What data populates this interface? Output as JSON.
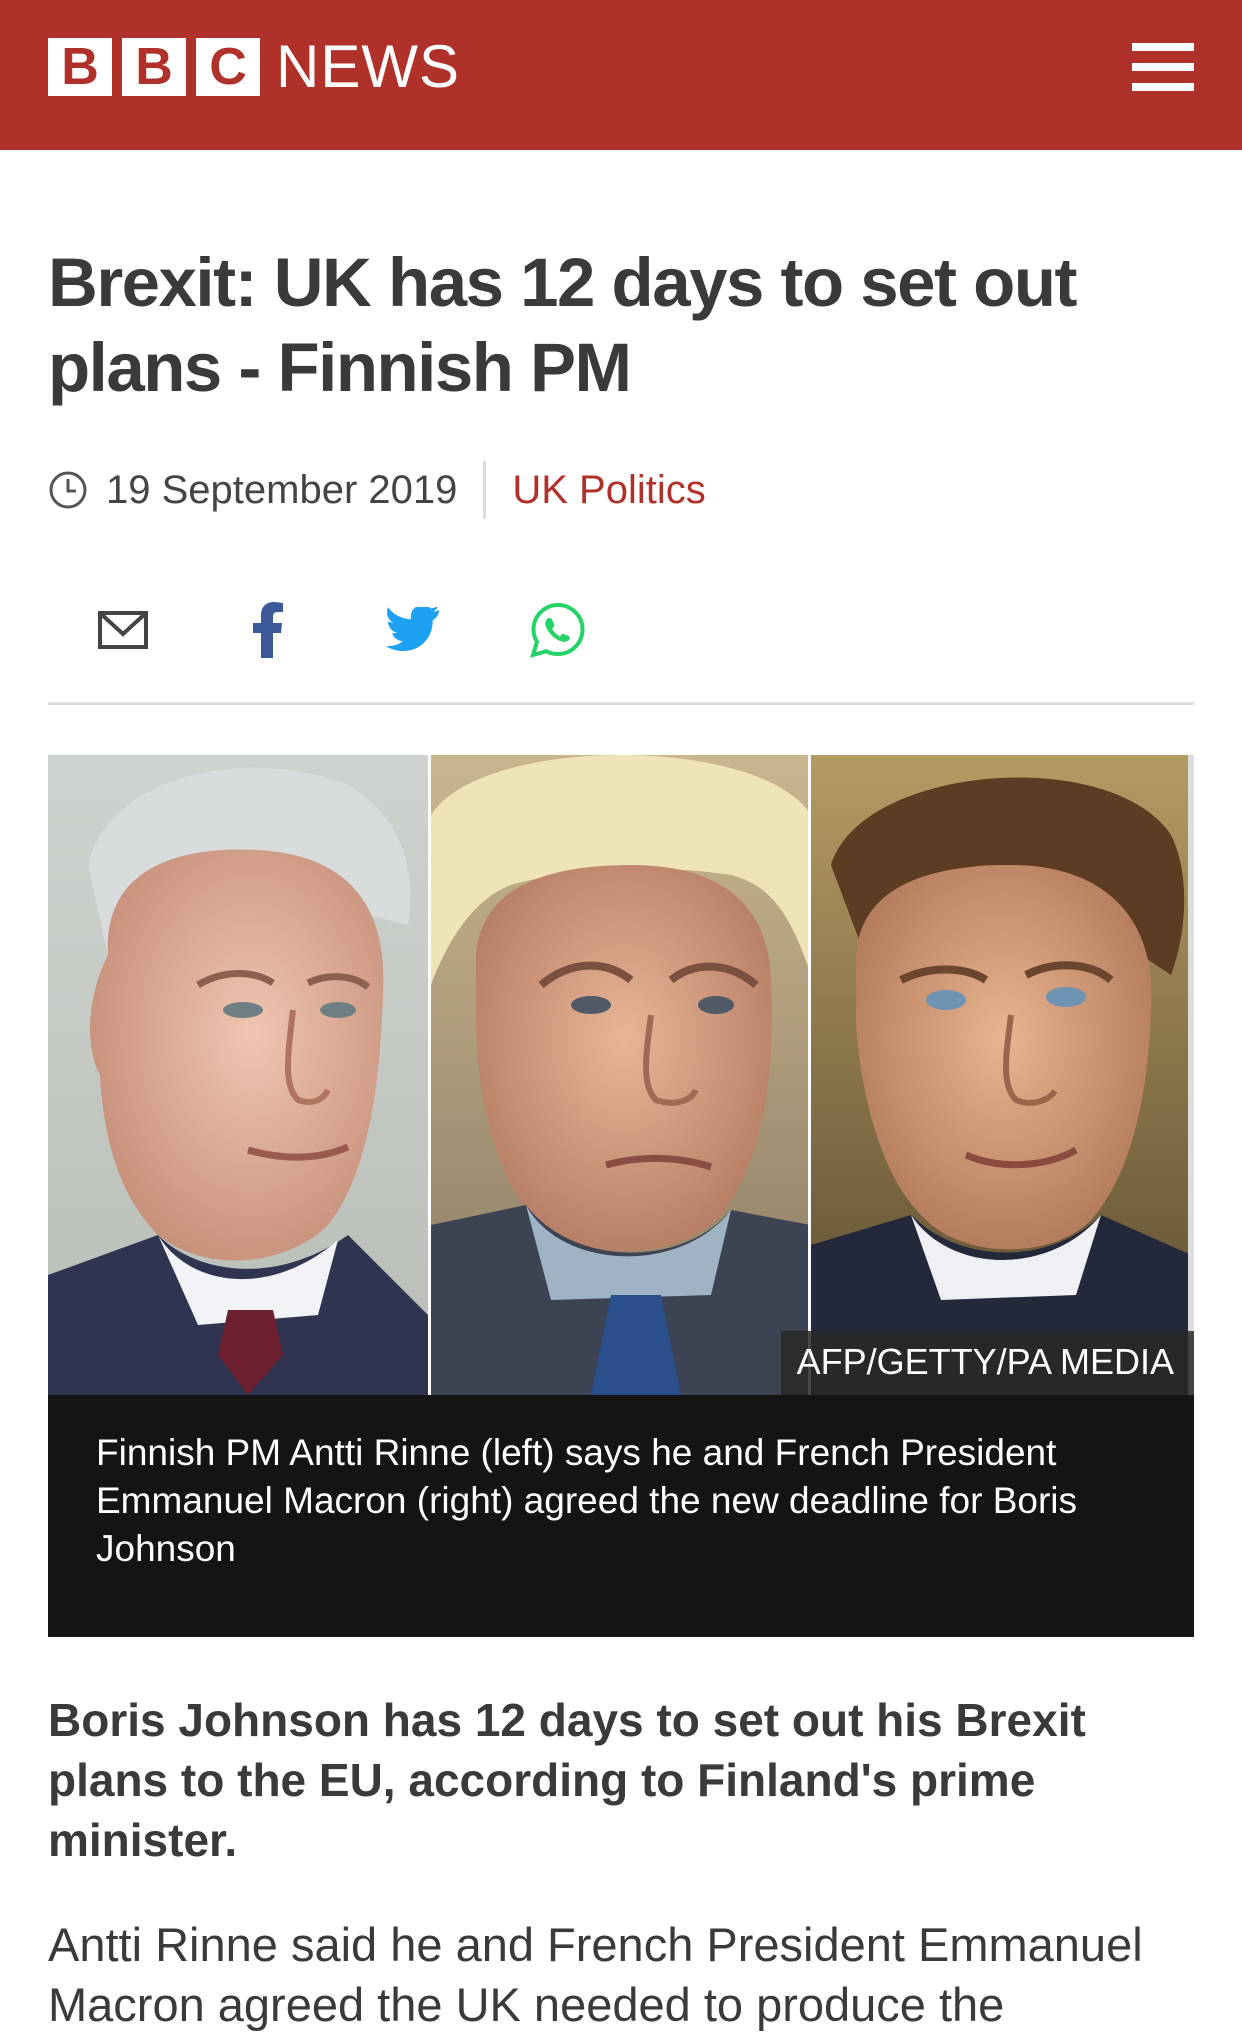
{
  "header": {
    "logo_letters": [
      "B",
      "B",
      "C"
    ],
    "logo_news": "NEWS",
    "brand_color": "#b0302a",
    "menu_icon": "hamburger-menu-icon"
  },
  "article": {
    "headline": "Brexit: UK has 12 days to set out plans - Finnish PM",
    "date": "19 September 2019",
    "category": "UK Politics",
    "share_icons": [
      "email-icon",
      "facebook-icon",
      "twitter-icon",
      "whatsapp-icon"
    ],
    "image": {
      "credit": "AFP/GETTY/PA MEDIA",
      "caption": "Finnish PM Antti Rinne (left) says he and French President Emmanuel Macron (right) agreed the new deadline for Boris Johnson"
    },
    "lead": "Boris Johnson has 12 days to set out his Brexit plans to the EU, according to Finland's prime minister.",
    "paragraph": "Antti Rinne said he and French President Emmanuel Macron agreed the UK needed to produce the"
  }
}
